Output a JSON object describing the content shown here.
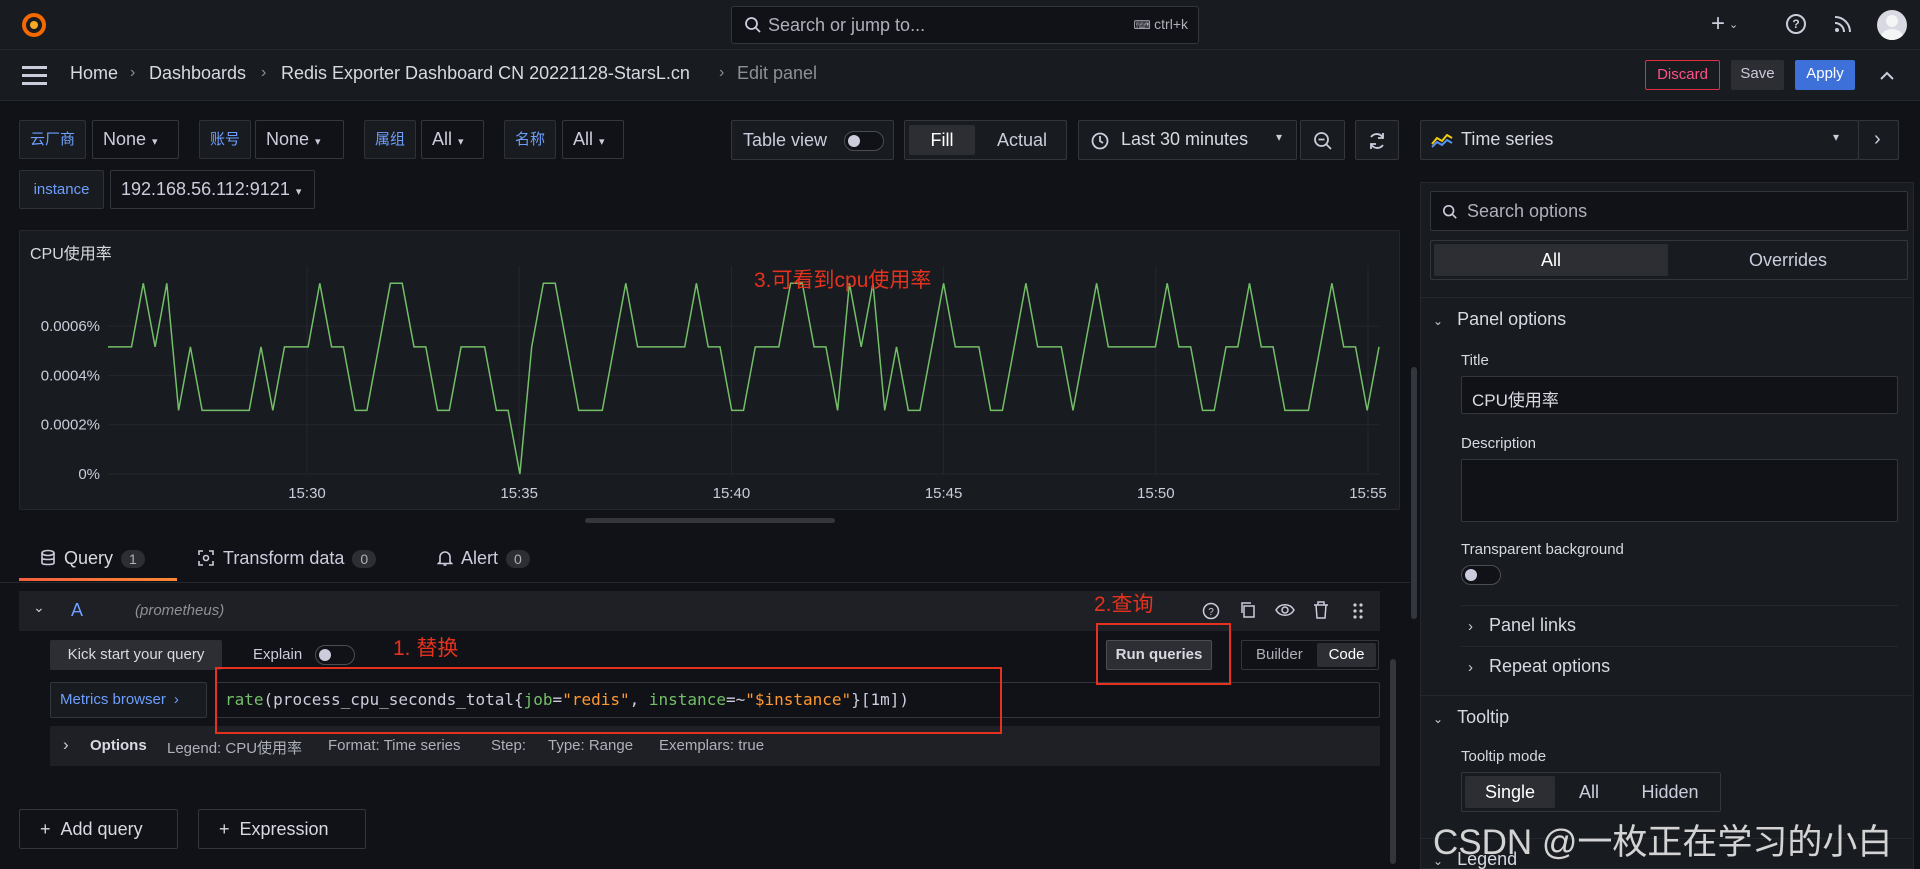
{
  "topbar": {
    "search_placeholder": "Search or jump to...",
    "search_shortcut": "ctrl+k",
    "add_label": "+"
  },
  "breadcrumb": {
    "items": [
      "Home",
      "Dashboards",
      "Redis Exporter Dashboard CN 20221128-StarsL.cn",
      "Edit panel"
    ]
  },
  "actions": {
    "discard": "Discard",
    "save": "Save",
    "apply": "Apply"
  },
  "variables": [
    {
      "label": "云厂商",
      "value": "None"
    },
    {
      "label": "账号",
      "value": "None"
    },
    {
      "label": "属组",
      "value": "All"
    },
    {
      "label": "名称",
      "value": "All"
    },
    {
      "label": "instance",
      "value": "192.168.56.112:9121"
    }
  ],
  "view_controls": {
    "table_view": "Table view",
    "fill": "Fill",
    "actual": "Actual",
    "time_range": "Last 30 minutes"
  },
  "panel": {
    "title": "CPU使用率"
  },
  "chart_data": {
    "type": "line",
    "title": "CPU使用率",
    "y_ticks": [
      "0%",
      "0.0002%",
      "0.0004%",
      "0.0006%"
    ],
    "x_ticks": [
      "15:30",
      "15:35",
      "15:40",
      "15:45",
      "15:50",
      "15:55"
    ],
    "ylim": [
      0,
      0.00072
    ],
    "grid": true,
    "color": "#73bf69",
    "series": [
      {
        "values": [
          0.00044,
          0.00044,
          0.00044,
          0.00066,
          0.00044,
          0.00066,
          0.00022,
          0.00044,
          0.00022,
          0.00022,
          0.00022,
          0.00022,
          0.00022,
          0.00044,
          0.00022,
          0.00044,
          0.00044,
          0.00044,
          0.00066,
          0.00044,
          0.00044,
          0.00022,
          0.00022,
          0.00044,
          0.00066,
          0.00066,
          0.00044,
          0.00044,
          0.00022,
          0.00022,
          0.00044,
          0.00044,
          0.00044,
          0.00022,
          0.00022,
          0.0,
          0.00044,
          0.00066,
          0.00066,
          0.00044,
          0.00022,
          0.00022,
          0.00022,
          0.00044,
          0.00066,
          0.00044,
          0.00044,
          0.00044,
          0.00044,
          0.00044,
          0.00066,
          0.00044,
          0.00044,
          0.00022,
          0.00022,
          0.00044,
          0.00044,
          0.00044,
          0.00066,
          0.00066,
          0.00044,
          0.00044,
          0.00022,
          0.00066,
          0.00044,
          0.00066,
          0.00022,
          0.00044,
          0.00022,
          0.00022,
          0.00044,
          0.00066,
          0.00044,
          0.00044,
          0.00044,
          0.00022,
          0.00022,
          0.00044,
          0.00066,
          0.00044,
          0.00044,
          0.00044,
          0.00022,
          0.00044,
          0.00066,
          0.00044,
          0.00044,
          0.00044,
          0.00044,
          0.00044,
          0.00066,
          0.00044,
          0.00044,
          0.00022,
          0.00022,
          0.00044,
          0.00044,
          0.00066,
          0.00044,
          0.00044,
          0.00022,
          0.00022,
          0.00022,
          0.00044,
          0.00066,
          0.00044,
          0.00044,
          0.00022,
          0.00044
        ]
      }
    ]
  },
  "annotations": {
    "a1": "1.  替换",
    "a2": "2.查询",
    "a3": "3.可看到cpu使用率"
  },
  "tabs": [
    {
      "label": "Query",
      "count": "1"
    },
    {
      "label": "Transform data",
      "count": "0"
    },
    {
      "label": "Alert",
      "count": "0"
    }
  ],
  "query": {
    "ref": "A",
    "datasource": "(prometheus)",
    "kick_start": "Kick start your query",
    "explain": "Explain",
    "run_queries": "Run queries",
    "builder": "Builder",
    "code": "Code",
    "metrics_browser": "Metrics browser",
    "expr_fn": "rate",
    "expr_open": "(",
    "expr_metric": "process_cpu_seconds_total",
    "expr_lbrace": "{",
    "expr_k1": "job",
    "expr_op1": "=",
    "expr_v1": "\"redis\"",
    "expr_comma": ", ",
    "expr_k2": "instance",
    "expr_op2": "=~",
    "expr_v2": "\"$instance\"",
    "expr_rbrace": "}",
    "expr_range": "[1m]",
    "expr_close": ")",
    "options": "Options",
    "legend": "Legend: CPU使用率",
    "format": "Format: Time series",
    "step": "Step:",
    "type": "Type: Range",
    "exemplars": "Exemplars: true"
  },
  "add_query": "Add query",
  "expression": "Expression",
  "right": {
    "viz": "Time series",
    "search_placeholder": "Search options",
    "tab_all": "All",
    "tab_overrides": "Overrides",
    "panel_options": "Panel options",
    "title_label": "Title",
    "title_value": "CPU使用率",
    "description_label": "Description",
    "transparent_label": "Transparent background",
    "panel_links": "Panel links",
    "repeat_options": "Repeat options",
    "tooltip": "Tooltip",
    "tooltip_mode": "Tooltip mode",
    "single": "Single",
    "all": "All",
    "hidden": "Hidden",
    "legend": "Legend"
  },
  "watermark": "CSDN @一枚正在学习的小白"
}
